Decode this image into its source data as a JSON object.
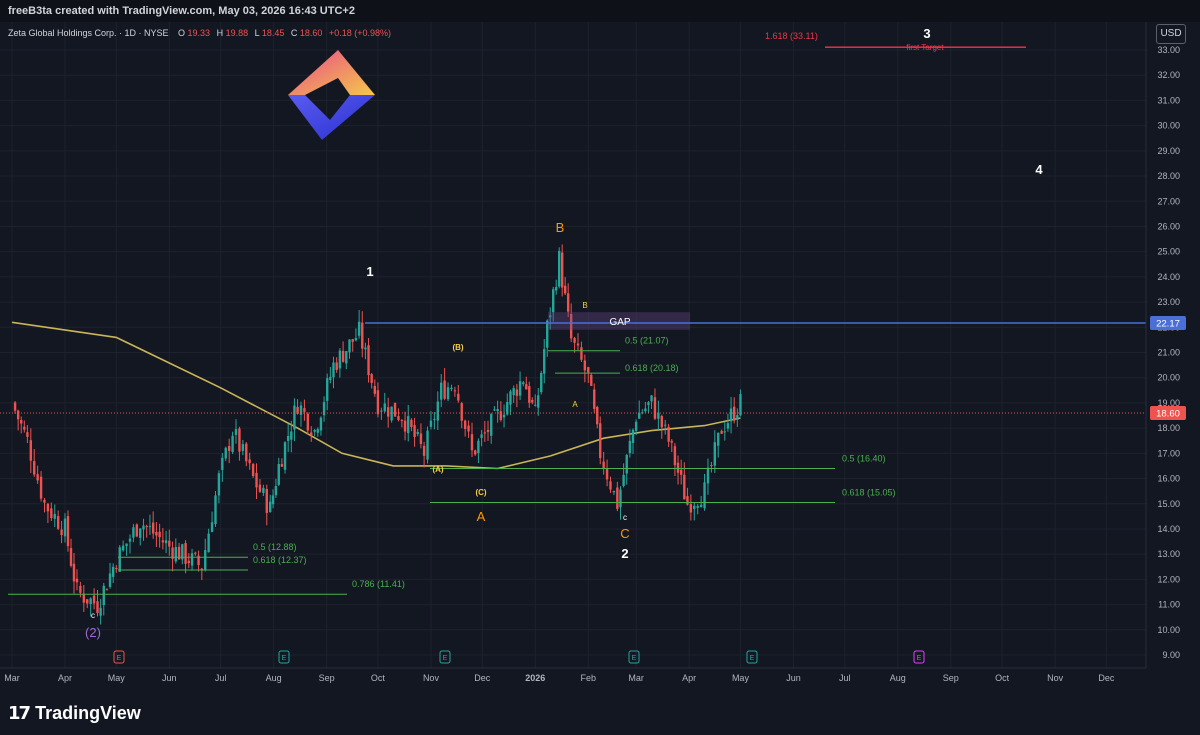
{
  "header": {
    "attribution": "freeB3ta created with TradingView.com, May 03, 2026 16:43 UTC+2"
  },
  "symbol": {
    "name": "Zeta Global Holdings Corp. · 1D · NYSE",
    "o_label": "O",
    "o": "19.33",
    "h_label": "H",
    "h": "19.88",
    "l_label": "L",
    "l": "18.45",
    "c_label": "C",
    "c": "18.60",
    "change": "+0.18 (+0.98%)"
  },
  "currency_button": "USD",
  "footer": {
    "brand": "TradingView",
    "brand_mark": "17"
  },
  "colors": {
    "bg": "#131722",
    "up": "#26a69a",
    "down": "#ef5350",
    "ma": "#c9b458",
    "fib": "#4caf50",
    "target": "#f23645",
    "gap": "#4a6fd6",
    "wave": "#ff9800",
    "minor": "#f5d142",
    "purple": "#9c6ad8"
  },
  "chart_data": {
    "type": "candlestick",
    "y_axis": {
      "min": 9.0,
      "max": 33.0,
      "ticks": [
        "9.00",
        "10.00",
        "11.00",
        "12.00",
        "13.00",
        "14.00",
        "15.00",
        "16.00",
        "17.00",
        "18.00",
        "19.00",
        "20.00",
        "21.00",
        "22.00",
        "23.00",
        "24.00",
        "25.00",
        "26.00",
        "27.00",
        "28.00",
        "29.00",
        "30.00",
        "31.00",
        "32.00",
        "33.00"
      ]
    },
    "x_axis": {
      "ticks": [
        "Mar",
        "Apr",
        "May",
        "Jun",
        "Jul",
        "Aug",
        "Sep",
        "Oct",
        "Nov",
        "Dec",
        "2026",
        "Feb",
        "Mar",
        "Apr",
        "May",
        "Jun",
        "Jul",
        "Aug",
        "Sep",
        "Oct",
        "Nov",
        "Dec"
      ]
    },
    "price_path": [
      [
        "2025-03-01",
        19.0
      ],
      [
        "2025-03-10",
        17.5
      ],
      [
        "2025-03-20",
        15.0
      ],
      [
        "2025-04-01",
        14.0
      ],
      [
        "2025-04-08",
        11.5
      ],
      [
        "2025-04-20",
        11.0
      ],
      [
        "2025-05-01",
        12.8
      ],
      [
        "2025-05-15",
        14.3
      ],
      [
        "2025-06-01",
        13.3
      ],
      [
        "2025-06-20",
        12.5
      ],
      [
        "2025-06-30",
        16.0
      ],
      [
        "2025-07-08",
        17.9
      ],
      [
        "2025-07-20",
        16.0
      ],
      [
        "2025-07-30",
        14.8
      ],
      [
        "2025-08-04",
        16.5
      ],
      [
        "2025-08-15",
        19.0
      ],
      [
        "2025-08-25",
        17.9
      ],
      [
        "2025-09-05",
        20.5
      ],
      [
        "2025-09-20",
        21.8
      ],
      [
        "2025-10-01",
        19.0
      ],
      [
        "2025-10-15",
        18.5
      ],
      [
        "2025-10-28",
        17.0
      ],
      [
        "2025-11-07",
        19.5
      ],
      [
        "2025-11-15",
        19.8
      ],
      [
        "2025-11-25",
        17.0
      ],
      [
        "2025-12-10",
        18.5
      ],
      [
        "2025-12-25",
        20.0
      ],
      [
        "2026-01-01",
        18.5
      ],
      [
        "2026-01-08",
        22.0
      ],
      [
        "2026-01-15",
        24.7
      ],
      [
        "2026-01-22",
        21.5
      ],
      [
        "2026-02-01",
        20.0
      ],
      [
        "2026-02-08",
        17.0
      ],
      [
        "2026-02-18",
        15.0
      ],
      [
        "2026-03-01",
        18.5
      ],
      [
        "2026-03-10",
        19.0
      ],
      [
        "2026-03-20",
        17.5
      ],
      [
        "2026-03-31",
        15.0
      ],
      [
        "2026-04-10",
        15.5
      ],
      [
        "2026-04-20",
        18.0
      ],
      [
        "2026-05-01",
        19.0
      ]
    ],
    "moving_average": [
      [
        "2025-03-01",
        22.2
      ],
      [
        "2025-05-01",
        21.6
      ],
      [
        "2025-07-01",
        19.6
      ],
      [
        "2025-08-15",
        18.0
      ],
      [
        "2025-09-10",
        17.0
      ],
      [
        "2025-10-10",
        16.5
      ],
      [
        "2025-11-10",
        16.5
      ],
      [
        "2025-12-10",
        16.4
      ],
      [
        "2026-01-10",
        16.9
      ],
      [
        "2026-02-10",
        17.6
      ],
      [
        "2026-03-10",
        17.9
      ],
      [
        "2026-04-10",
        18.1
      ],
      [
        "2026-05-01",
        18.4
      ]
    ],
    "last_price": "18.60",
    "gap_level": "22.17",
    "gap_label": "GAP",
    "fib_levels": [
      {
        "label": "0.5 (21.07)",
        "value": 21.07
      },
      {
        "label": "0.618 (20.18)",
        "value": 20.18
      },
      {
        "label": "0.5 (16.40)",
        "value": 16.4
      },
      {
        "label": "0.618 (15.05)",
        "value": 15.05
      },
      {
        "label": "0.5 (12.88)",
        "value": 12.88
      },
      {
        "label": "0.618 (12.37)",
        "value": 12.37
      },
      {
        "label": "0.786 (11.41)",
        "value": 11.41
      }
    ],
    "target": {
      "label": "1.618 (33.11)",
      "value": 33.11,
      "note": "first Target"
    },
    "wave_labels": {
      "w1": "1",
      "w2": "2",
      "w3": "3",
      "w4": "4",
      "w2p": "(2)",
      "A": "A",
      "B": "B",
      "C": "C",
      "sA": "A",
      "sB": "B",
      "sc1": "c",
      "sc2": "c",
      "pA": "(A)",
      "pB": "(B)",
      "pC": "(C)"
    },
    "earnings_label": "E"
  }
}
